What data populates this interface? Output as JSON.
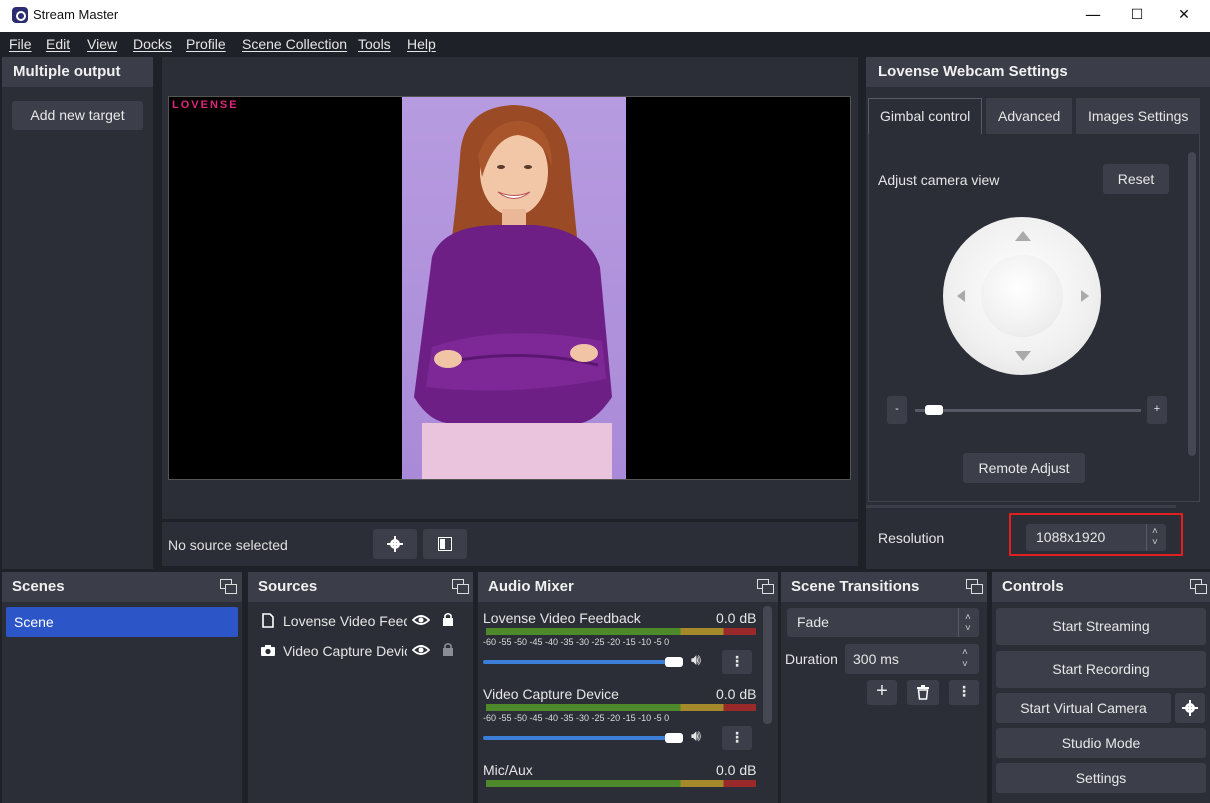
{
  "window": {
    "title": "Stream Master",
    "controls": {
      "minimize": "—",
      "maximize": "☐",
      "close": "✕"
    }
  },
  "menubar": [
    "File",
    "Edit",
    "View",
    "Docks",
    "Profile",
    "Scene Collection",
    "Tools",
    "Help"
  ],
  "multiple_output": {
    "title": "Multiple output",
    "add_button": "Add new target"
  },
  "preview": {
    "watermark": "LOVENSE",
    "status": "No source selected"
  },
  "webcam_settings": {
    "title": "Lovense Webcam Settings",
    "tabs": [
      "Gimbal control",
      "Advanced",
      "Images Settings"
    ],
    "active_tab": "Gimbal control",
    "adjust_label": "Adjust camera view",
    "reset_label": "Reset",
    "zoom_minus": "-",
    "zoom_plus": "+",
    "zoom_level": 0.05,
    "remote_adjust_label": "Remote Adjust",
    "resolution_label": "Resolution",
    "resolution_value": "1088x1920"
  },
  "scenes": {
    "title": "Scenes",
    "items": [
      "Scene"
    ]
  },
  "sources": {
    "title": "Sources",
    "items": [
      {
        "label": "Lovense Video Feed"
      },
      {
        "label": "Video Capture Devic"
      }
    ]
  },
  "audio_mixer": {
    "title": "Audio Mixer",
    "ticks": "-60 -55 -50 -45 -40 -35 -30 -25 -20 -15 -10 -5 0",
    "channels": [
      {
        "name": "Lovense Video Feedback",
        "level": "0.0 dB",
        "volume": 1.0
      },
      {
        "name": "Video Capture Device",
        "level": "0.0 dB",
        "volume": 1.0
      },
      {
        "name": "Mic/Aux",
        "level": "0.0 dB"
      }
    ]
  },
  "scene_transitions": {
    "title": "Scene Transitions",
    "transition": "Fade",
    "duration_label": "Duration",
    "duration_value": "300 ms"
  },
  "controls": {
    "title": "Controls",
    "start_streaming": "Start Streaming",
    "start_recording": "Start Recording",
    "start_virtual_camera": "Start Virtual Camera",
    "studio_mode": "Studio Mode",
    "settings": "Settings"
  },
  "colors": {
    "accent_selected": "#2c55c8",
    "highlight_box": "#e02020",
    "volume_track": "#3c7dd8"
  }
}
